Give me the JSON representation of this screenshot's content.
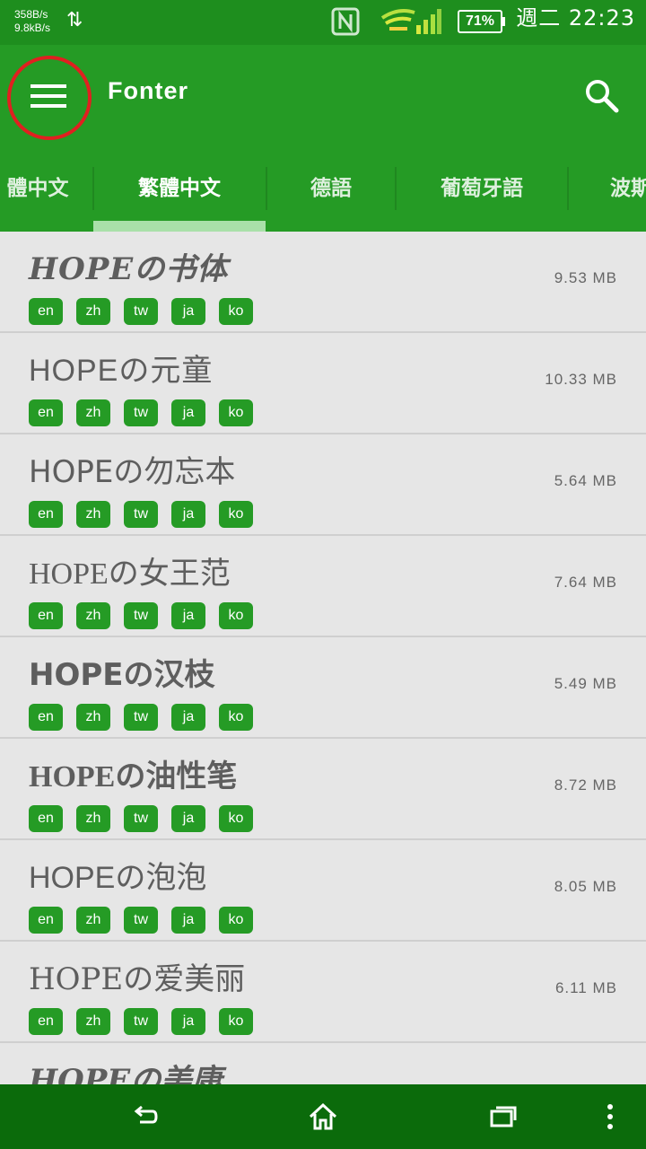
{
  "status_bar": {
    "upload_speed": "358B/s",
    "download_speed": "9.8kB/s",
    "battery_percent": "71%",
    "clock": "週二 22:23",
    "icons": [
      "data-transfer-icon",
      "nfc-icon",
      "signal-icon",
      "battery-icon"
    ]
  },
  "app_bar": {
    "title": "Fonter",
    "menu_icon": "menu-icon",
    "search_icon": "search-icon",
    "highlight_color": "#e02020"
  },
  "tabs": [
    {
      "label": "體中文"
    },
    {
      "label": "繁體中文",
      "active": true
    },
    {
      "label": "德語"
    },
    {
      "label": "葡萄牙語"
    },
    {
      "label": "波斯"
    }
  ],
  "fonts": [
    {
      "name": "HOPEの书体",
      "size": "9.53 MB",
      "tags": [
        "en",
        "zh",
        "tw",
        "ja",
        "ko"
      ]
    },
    {
      "name": "HOPEの元童",
      "size": "10.33 MB",
      "tags": [
        "en",
        "zh",
        "tw",
        "ja",
        "ko"
      ]
    },
    {
      "name": "HOPEの勿忘本",
      "size": "5.64 MB",
      "tags": [
        "en",
        "zh",
        "tw",
        "ja",
        "ko"
      ]
    },
    {
      "name": "HOPEの女王范",
      "size": "7.64 MB",
      "tags": [
        "en",
        "zh",
        "tw",
        "ja",
        "ko"
      ]
    },
    {
      "name": "HOPEの汉枝",
      "size": "5.49 MB",
      "tags": [
        "en",
        "zh",
        "tw",
        "ja",
        "ko"
      ]
    },
    {
      "name": "HOPEの油性笔",
      "size": "8.72 MB",
      "tags": [
        "en",
        "zh",
        "tw",
        "ja",
        "ko"
      ]
    },
    {
      "name": "HOPEの泡泡",
      "size": "8.05 MB",
      "tags": [
        "en",
        "zh",
        "tw",
        "ja",
        "ko"
      ]
    },
    {
      "name": "HOPEの爱美丽",
      "size": "6.11 MB",
      "tags": [
        "en",
        "zh",
        "tw",
        "ja",
        "ko"
      ]
    },
    {
      "name": "HOPEの美康",
      "size": "",
      "tags": []
    }
  ],
  "nav_bar": {
    "icons": [
      "back-icon",
      "home-icon",
      "recents-icon",
      "overflow-menu-icon"
    ]
  },
  "colors": {
    "status_bar": "#1e8e1e",
    "app_bar": "#259b25",
    "tab_indicator": "#a9e0a9",
    "tag_bg": "#259b25",
    "list_bg": "#e6e6e6",
    "nav_bar": "#0b6b0b"
  }
}
